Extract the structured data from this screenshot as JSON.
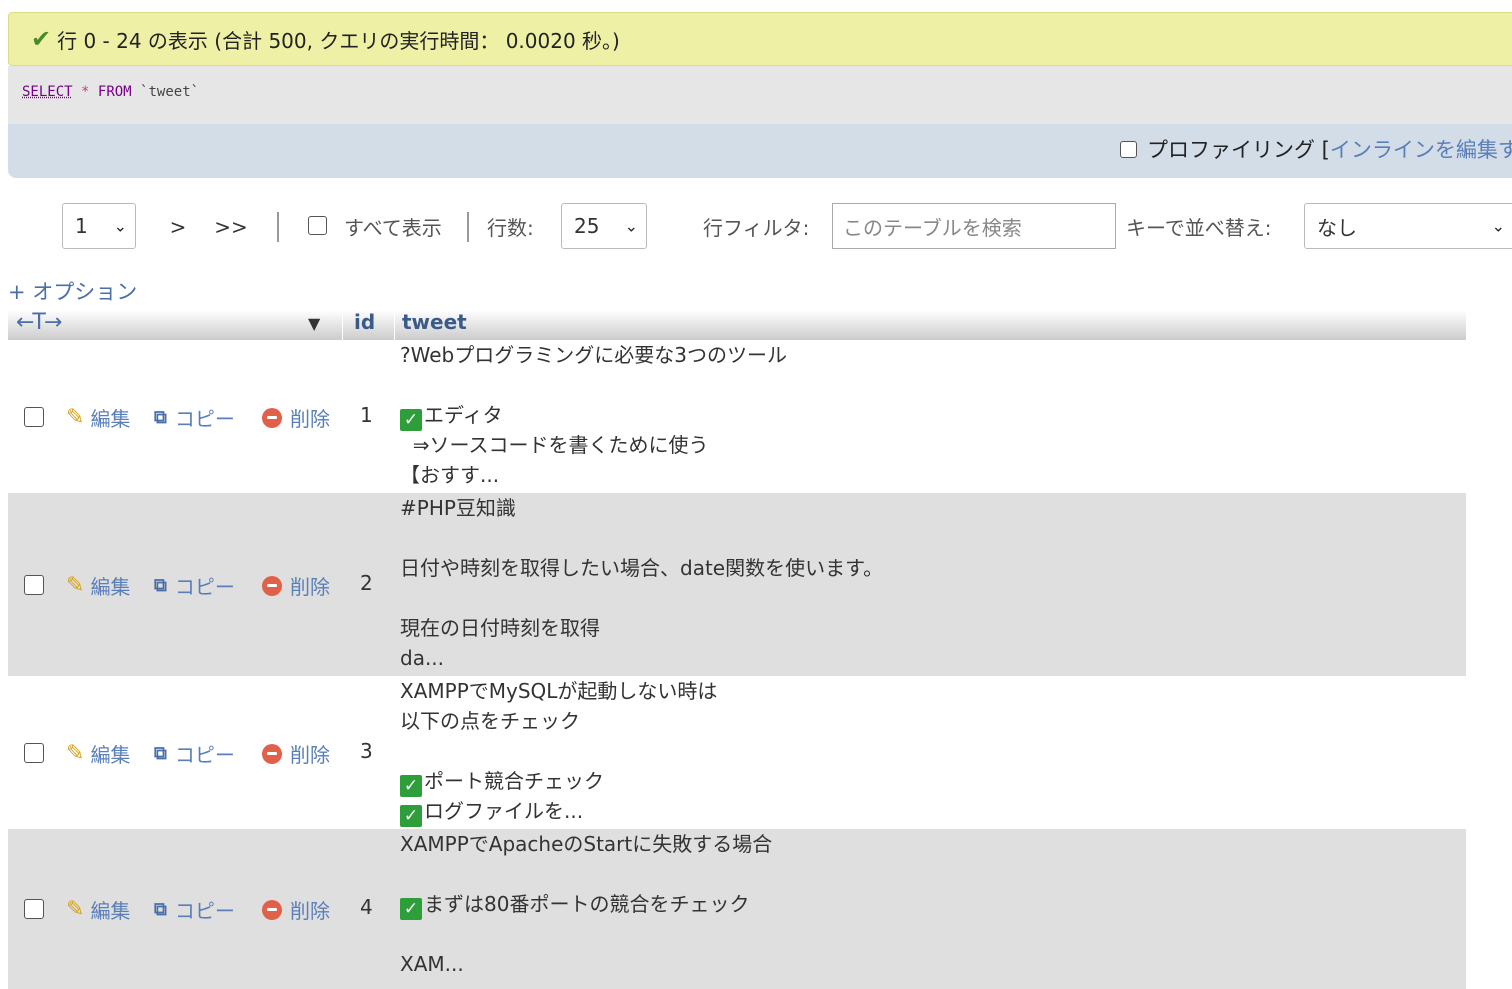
{
  "query_result": {
    "message": "行 0 - 24 の表示 (合計 500, クエリの実行時間： 0.0020 秒。)"
  },
  "sql": {
    "select": "SELECT",
    "star": "*",
    "from": "FROM",
    "table": "`tweet`"
  },
  "toolbar": {
    "profiling_label": "プロファイリング [",
    "inline_edit_label": "インラインを編集す"
  },
  "navigation": {
    "page_select": "1",
    "next_label": ">",
    "last_label": ">>",
    "show_all_label": "すべて表示",
    "rows_label": "行数:",
    "rows_value": "25",
    "filter_label": "行フィルタ:",
    "filter_placeholder": "このテーブルを検索",
    "sort_label": "キーで並べ替え:",
    "sort_value": "なし"
  },
  "options_label": "+ オプション",
  "table": {
    "arrows_label": "←T→",
    "columns": [
      "id",
      "tweet"
    ],
    "action_labels": {
      "edit": "編集",
      "copy": "コピー",
      "delete": "削除"
    },
    "rows": [
      {
        "id": "1",
        "lines": [
          {
            "check": false,
            "text": "?Webプログラミングに必要な3つのツール"
          },
          {
            "check": false,
            "text": ""
          },
          {
            "check": true,
            "text": "エディタ"
          },
          {
            "check": false,
            "text": "  ⇒ソースコードを書くために使う"
          },
          {
            "check": false,
            "text": "【おすす..."
          }
        ]
      },
      {
        "id": "2",
        "lines": [
          {
            "check": false,
            "text": "#PHP豆知識"
          },
          {
            "check": false,
            "text": ""
          },
          {
            "check": false,
            "text": "日付や時刻を取得したい場合、date関数を使います。"
          },
          {
            "check": false,
            "text": ""
          },
          {
            "check": false,
            "text": "現在の日付時刻を取得"
          },
          {
            "check": false,
            "text": "da..."
          }
        ]
      },
      {
        "id": "3",
        "lines": [
          {
            "check": false,
            "text": "XAMPPでMySQLが起動しない時は"
          },
          {
            "check": false,
            "text": "以下の点をチェック"
          },
          {
            "check": false,
            "text": ""
          },
          {
            "check": true,
            "text": "ポート競合チェック"
          },
          {
            "check": true,
            "text": "ログファイルを..."
          }
        ]
      },
      {
        "id": "4",
        "lines": [
          {
            "check": false,
            "text": "XAMPPでApacheのStartに失敗する場合"
          },
          {
            "check": false,
            "text": ""
          },
          {
            "check": true,
            "text": "まずは80番ポートの競合をチェック"
          },
          {
            "check": false,
            "text": ""
          },
          {
            "check": false,
            "text": "XAM..."
          }
        ]
      }
    ]
  }
}
